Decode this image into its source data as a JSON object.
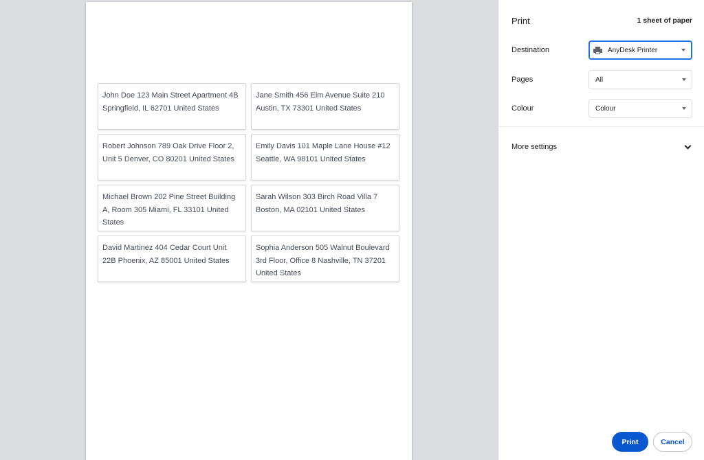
{
  "preview": {
    "labels": [
      "John Doe 123 Main Street Apartment 4B Springfield, IL 62701 United States",
      "Jane Smith 456 Elm Avenue Suite 210 Austin, TX 73301 United States",
      "Robert Johnson 789 Oak Drive Floor 2, Unit 5 Denver, CO 80201 United States",
      "Emily Davis 101 Maple Lane House #12 Seattle, WA 98101 United States",
      "Michael Brown 202 Pine Street Building A, Room 305 Miami, FL 33101 United States",
      "Sarah Wilson 303 Birch Road Villa 7 Boston, MA 02101 United States",
      "David Martinez 404 Cedar Court Unit 22B Phoenix, AZ 85001 United States",
      "Sophia Anderson 505 Walnut Boulevard 3rd Floor, Office 8 Nashville, TN 37201 United States"
    ]
  },
  "panel": {
    "title": "Print",
    "sheet_count": "1 sheet of paper",
    "destination": {
      "label": "Destination",
      "value": "AnyDesk Printer",
      "icon": "printer-icon"
    },
    "pages": {
      "label": "Pages",
      "value": "All"
    },
    "colour": {
      "label": "Colour",
      "value": "Colour"
    },
    "more_settings": "More settings",
    "print_button": "Print",
    "cancel_button": "Cancel"
  },
  "colors": {
    "accent": "#1a73e8",
    "print_button_bg": "#0b57d0",
    "preview_bg": "#dadce0"
  }
}
